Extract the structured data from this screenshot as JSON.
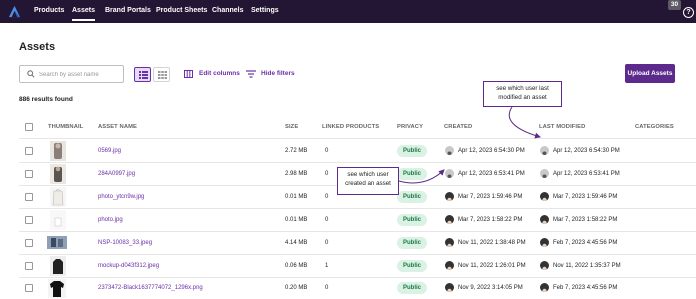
{
  "nav": {
    "items": [
      {
        "label": "Products",
        "active": false
      },
      {
        "label": "Assets",
        "active": true
      },
      {
        "label": "Brand Portals",
        "active": false
      },
      {
        "label": "Product Sheets",
        "active": false
      },
      {
        "label": "Channels",
        "active": false
      },
      {
        "label": "Settings",
        "active": false
      }
    ],
    "badge_count": "30",
    "help_icon": "?"
  },
  "page": {
    "title": "Assets",
    "search_placeholder": "Search by asset name",
    "edit_columns_label": "Edit columns",
    "hide_filters_label": "Hide filters",
    "upload_label": "Upload Assets",
    "results_label": "886 results found"
  },
  "table": {
    "headers": {
      "thumbnail": "THUMBNAIL",
      "asset_name": "ASSET NAME",
      "size": "SIZE",
      "linked_products": "LINKED PRODUCTS",
      "privacy": "PRIVACY",
      "created": "CREATED",
      "last_modified": "LAST MODIFIED",
      "categories": "CATEGORIES"
    },
    "rows": [
      {
        "name": "0569.jpg",
        "size": "2.72 MB",
        "linked": "0",
        "privacy": "Public",
        "created": "Apr 12, 2023 6:54:30 PM",
        "modified": "Apr 12, 2023 6:54:30 PM"
      },
      {
        "name": "284A0997.jpg",
        "size": "2.98 MB",
        "linked": "0",
        "privacy": "Public",
        "created": "Apr 12, 2023 6:53:41 PM",
        "modified": "Apr 12, 2023 6:53:41 PM"
      },
      {
        "name": "photo_ytcn9w.jpg",
        "size": "0.01 MB",
        "linked": "0",
        "privacy": "Public",
        "created": "Mar 7, 2023 1:59:46 PM",
        "modified": "Mar 7, 2023 1:59:46 PM"
      },
      {
        "name": "photo.jpg",
        "size": "0.01 MB",
        "linked": "0",
        "privacy": "Public",
        "created": "Mar 7, 2023 1:58:22 PM",
        "modified": "Mar 7, 2023 1:58:22 PM"
      },
      {
        "name": "NSP-10083_33.jpeg",
        "size": "4.14 MB",
        "linked": "0",
        "privacy": "Public",
        "created": "Nov 11, 2022 1:38:48 PM",
        "modified": "Feb 7, 2023 4:45:56 PM"
      },
      {
        "name": "mockup-d043f312.jpeg",
        "size": "0.06 MB",
        "linked": "1",
        "privacy": "Public",
        "created": "Nov 11, 2022 1:26:01 PM",
        "modified": "Nov 11, 2022 1:35:37 PM"
      },
      {
        "name": "2373472-Black1637774072_1296x.png",
        "size": "0.20 MB",
        "linked": "0",
        "privacy": "Public",
        "created": "Nov 9, 2022 3:14:05 PM",
        "modified": "Feb 7, 2023 4:45:56 PM"
      }
    ]
  },
  "callouts": {
    "last_modified_line1": "see which user last",
    "last_modified_line2": "modified an asset",
    "created_line1": "see which user",
    "created_line2": "created an asset"
  },
  "colors": {
    "nav_bg": "#231534",
    "accent": "#6b2fa8",
    "upload_bg": "#5b2a8c",
    "public_bg": "#d9f2e3",
    "public_text": "#1d7a43"
  }
}
